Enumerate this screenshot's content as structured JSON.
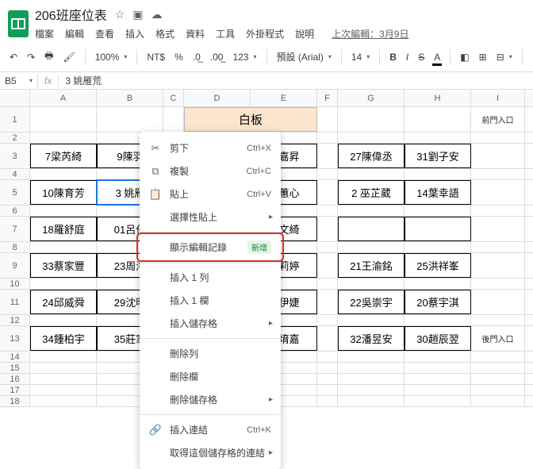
{
  "doc": {
    "title": "206班座位表"
  },
  "menu": {
    "file": "檔案",
    "edit": "編輯",
    "view": "查看",
    "insert": "插入",
    "format": "格式",
    "data": "資料",
    "tools": "工具",
    "addons": "外掛程式",
    "help": "說明",
    "last_edit": "上次編輯：3月9日"
  },
  "toolbar": {
    "zoom": "100%",
    "currency": "NT$",
    "percent": "%",
    "dec_dec": ".0←",
    "inc_dec": ".00→",
    "num_fmt": "123",
    "font": "預設 (Arial)",
    "size": "14",
    "bold": "B",
    "italic": "I",
    "strike": "S",
    "text_color": "A",
    "fill": "⬛",
    "borders": "⊞",
    "merge": "⊟"
  },
  "formula": {
    "cell_ref": "B5",
    "fx": "fx",
    "value": "3 姚雁荒"
  },
  "col_headers": [
    "A",
    "B",
    "C",
    "D",
    "E",
    "F",
    "G",
    "H",
    "I"
  ],
  "row_headers": [
    "1",
    "2",
    "3",
    "4",
    "5",
    "6",
    "7",
    "8",
    "9",
    "10",
    "11",
    "12",
    "13",
    "14",
    "15",
    "16",
    "17",
    "18"
  ],
  "whiteboard": "白板",
  "entrances": {
    "front": "前門入口",
    "back": "後門入口"
  },
  "seats": {
    "r3": {
      "A": "7梁芮綺",
      "B": "9陳羽",
      "E": "曾嘉昇",
      "G": "27陳偉丞",
      "H": "31劉子安"
    },
    "r5": {
      "A": "10陳育芳",
      "B": "3 姚雁",
      "E": "張蕙心",
      "G": "2 巫芷葳",
      "H": "14葉幸語"
    },
    "r7": {
      "A": "18羅舒庭",
      "B": "01呂侑",
      "E": "詹文綺"
    },
    "r9": {
      "A": "33蔡家豐",
      "B": "23周濬",
      "E": "黃莉婷",
      "G": "21王渝銘",
      "H": "25洪祥峯"
    },
    "r11": {
      "A": "24邱威舜",
      "B": "29沈明",
      "E": "曾伊婕",
      "G": "22吳崇宇",
      "H": "20蔡宇淇"
    },
    "r13": {
      "A": "34鍾柏宇",
      "B": "35莊家",
      "E": "彭堉嘉",
      "G": "32潘昱安",
      "H": "30趙辰翌"
    }
  },
  "ctx": {
    "cut": "剪下",
    "cut_k": "Ctrl+X",
    "copy": "複製",
    "copy_k": "Ctrl+C",
    "paste": "貼上",
    "paste_k": "Ctrl+V",
    "paste_special": "選擇性貼上",
    "show_edit_history": "顯示編輯記錄",
    "new_badge": "新增",
    "insert_row": "插入 1 列",
    "insert_col": "插入 1 欄",
    "insert_cells": "插入儲存格",
    "delete_row": "刪除列",
    "delete_col": "刪除欄",
    "delete_cells": "刪除儲存格",
    "insert_link": "插入連結",
    "insert_link_k": "Ctrl+K",
    "get_link": "取得這個儲存格的連結"
  }
}
